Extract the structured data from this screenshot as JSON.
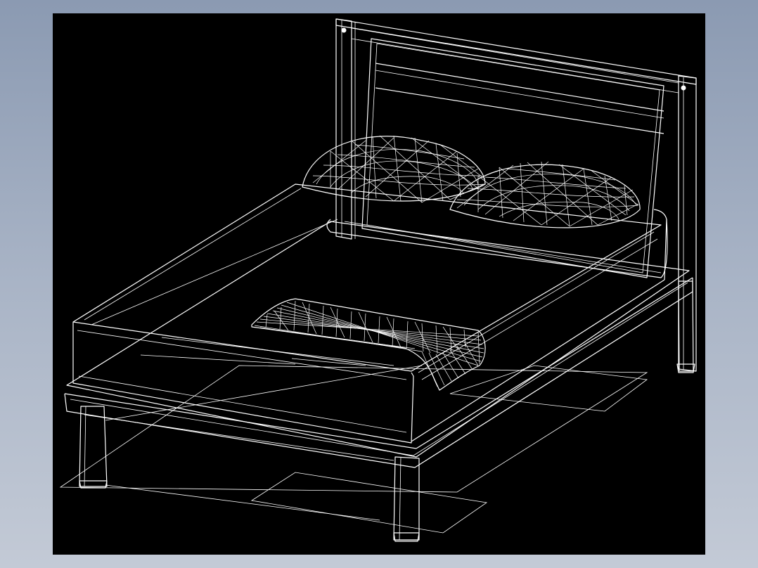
{
  "scene": {
    "subject": "bed",
    "render_style": "wireframe",
    "colors": {
      "outer_background_top": "#8b9ab2",
      "outer_background_bottom": "#c3cad6",
      "viewport_background": "#000000",
      "stroke": "#ffffff"
    }
  }
}
